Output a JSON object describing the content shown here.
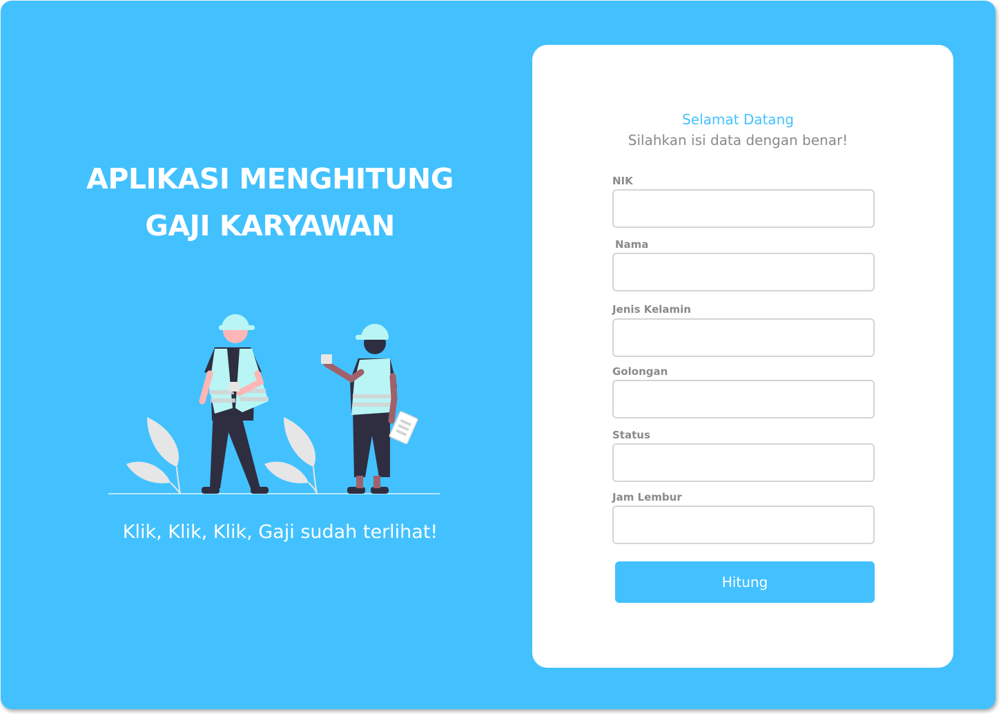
{
  "hero": {
    "title_line1": "APLIKASI MENGHITUNG",
    "title_line2": "GAJI KARYAWAN",
    "illustration": "construction-workers-illustration",
    "tagline": "Klik, Klik, Klik, Gaji sudah terlihat!"
  },
  "form": {
    "welcome": "Selamat Datang",
    "subtitle": "Silahkan isi data dengan benar!",
    "fields": [
      {
        "label": "NIK",
        "value": ""
      },
      {
        "label": "Nama",
        "value": ""
      },
      {
        "label": "Jenis Kelamin",
        "value": ""
      },
      {
        "label": "Golongan",
        "value": ""
      },
      {
        "label": "Status",
        "value": ""
      },
      {
        "label": "Jam Lembur",
        "value": ""
      }
    ],
    "submit_label": "Hitung"
  },
  "colors": {
    "primary": "#42c1fe",
    "card": "#ffffff",
    "label": "#8a8a8a",
    "input_border": "#d4d4d4",
    "vest": "#b8f5f4",
    "dark": "#2f2e41"
  }
}
